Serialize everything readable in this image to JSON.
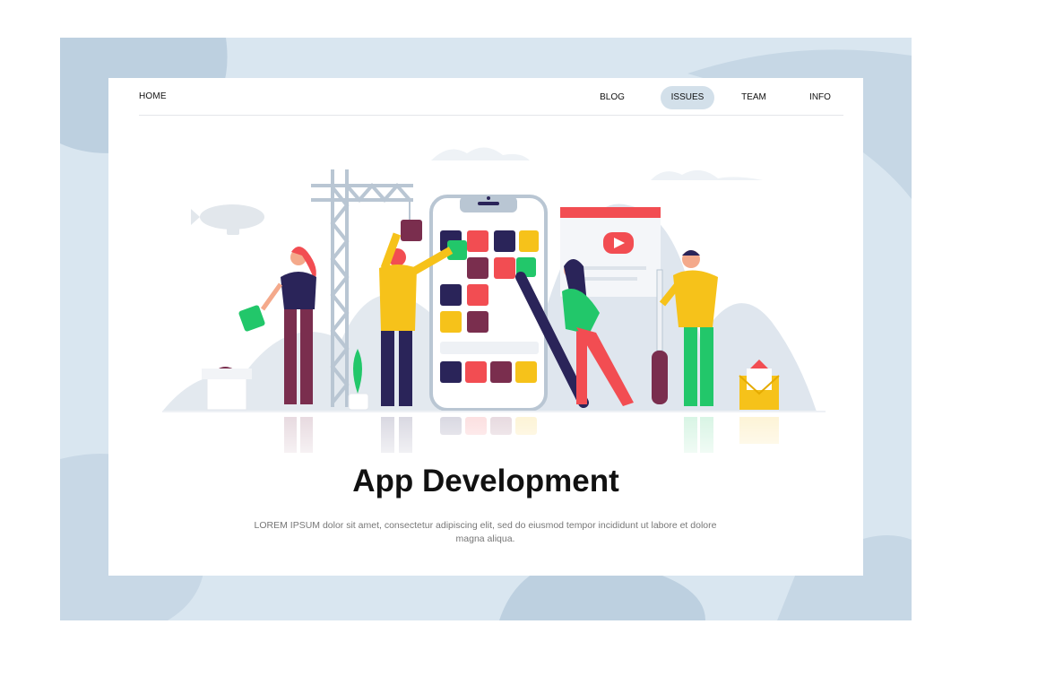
{
  "nav": {
    "home": "HOME",
    "links": [
      {
        "label": "BLOG",
        "active": false
      },
      {
        "label": "ISSUES",
        "active": true
      },
      {
        "label": "TEAM",
        "active": false
      },
      {
        "label": "INFO",
        "active": false
      }
    ]
  },
  "hero": {
    "title": "App Development",
    "description": "LOREM IPSUM dolor sit amet, consectetur adipiscing elit, sed do eiusmod tempor incididunt ut labore et dolore magna aliqua."
  },
  "colors": {
    "backdrop": "#d9e6f0",
    "backdrop_blob": "#bdd0e0",
    "active_pill": "#d3e0ea",
    "navy": "#2a2459",
    "red": "#f24d52",
    "maroon": "#7a2e4e",
    "yellow": "#f6c21a",
    "green": "#22c76a"
  }
}
